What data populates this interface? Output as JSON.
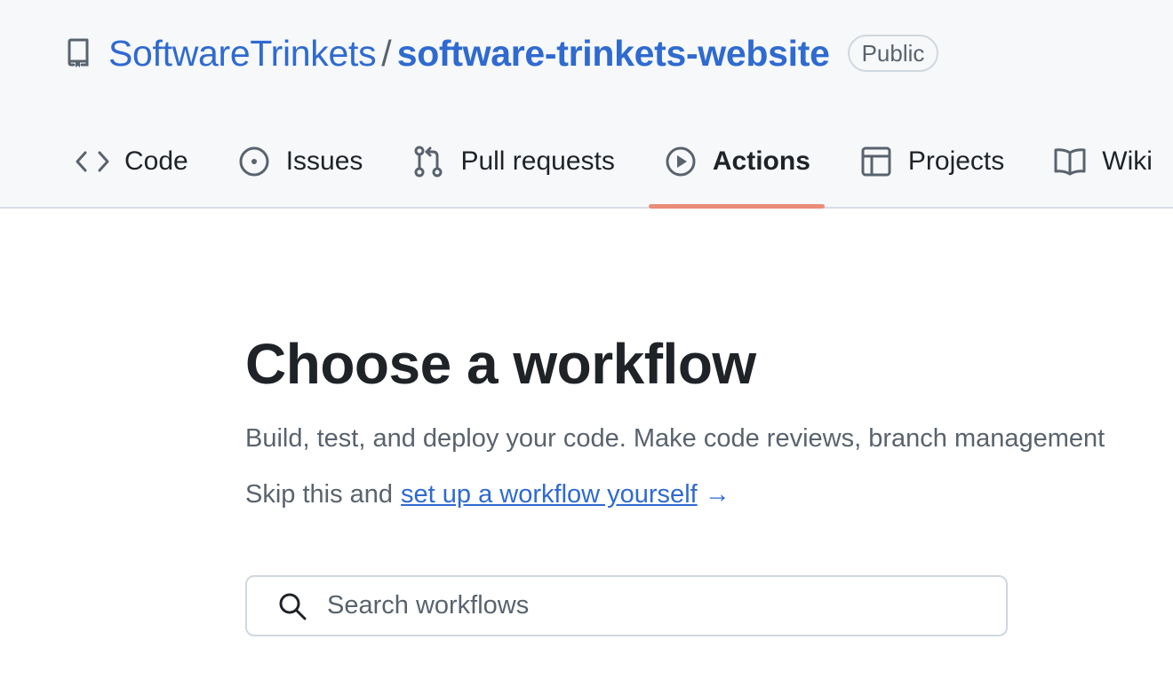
{
  "repo": {
    "owner": "SoftwareTrinkets",
    "separator": "/",
    "name": "software-trinkets-website",
    "visibility": "Public",
    "icon": "repo-icon"
  },
  "tabs": [
    {
      "label": "Code",
      "icon": "code-icon",
      "active": false
    },
    {
      "label": "Issues",
      "icon": "issue-opened-icon",
      "active": false
    },
    {
      "label": "Pull requests",
      "icon": "git-pull-request-icon",
      "active": false
    },
    {
      "label": "Actions",
      "icon": "play-icon",
      "active": true
    },
    {
      "label": "Projects",
      "icon": "table-icon",
      "active": false
    },
    {
      "label": "Wiki",
      "icon": "book-icon",
      "active": false
    }
  ],
  "main": {
    "title": "Choose a workflow",
    "description": "Build, test, and deploy your code. Make code reviews, branch management",
    "skip_prefix": "Skip this and",
    "skip_link": "set up a workflow yourself",
    "skip_arrow": "→"
  },
  "search": {
    "placeholder": "Search workflows",
    "icon": "search-icon"
  },
  "colors": {
    "link": "#2f6ad0",
    "active_underline": "#ea8c77",
    "header_bg": "#f6f8fa",
    "text": "#1f2328",
    "muted": "#59636e"
  }
}
